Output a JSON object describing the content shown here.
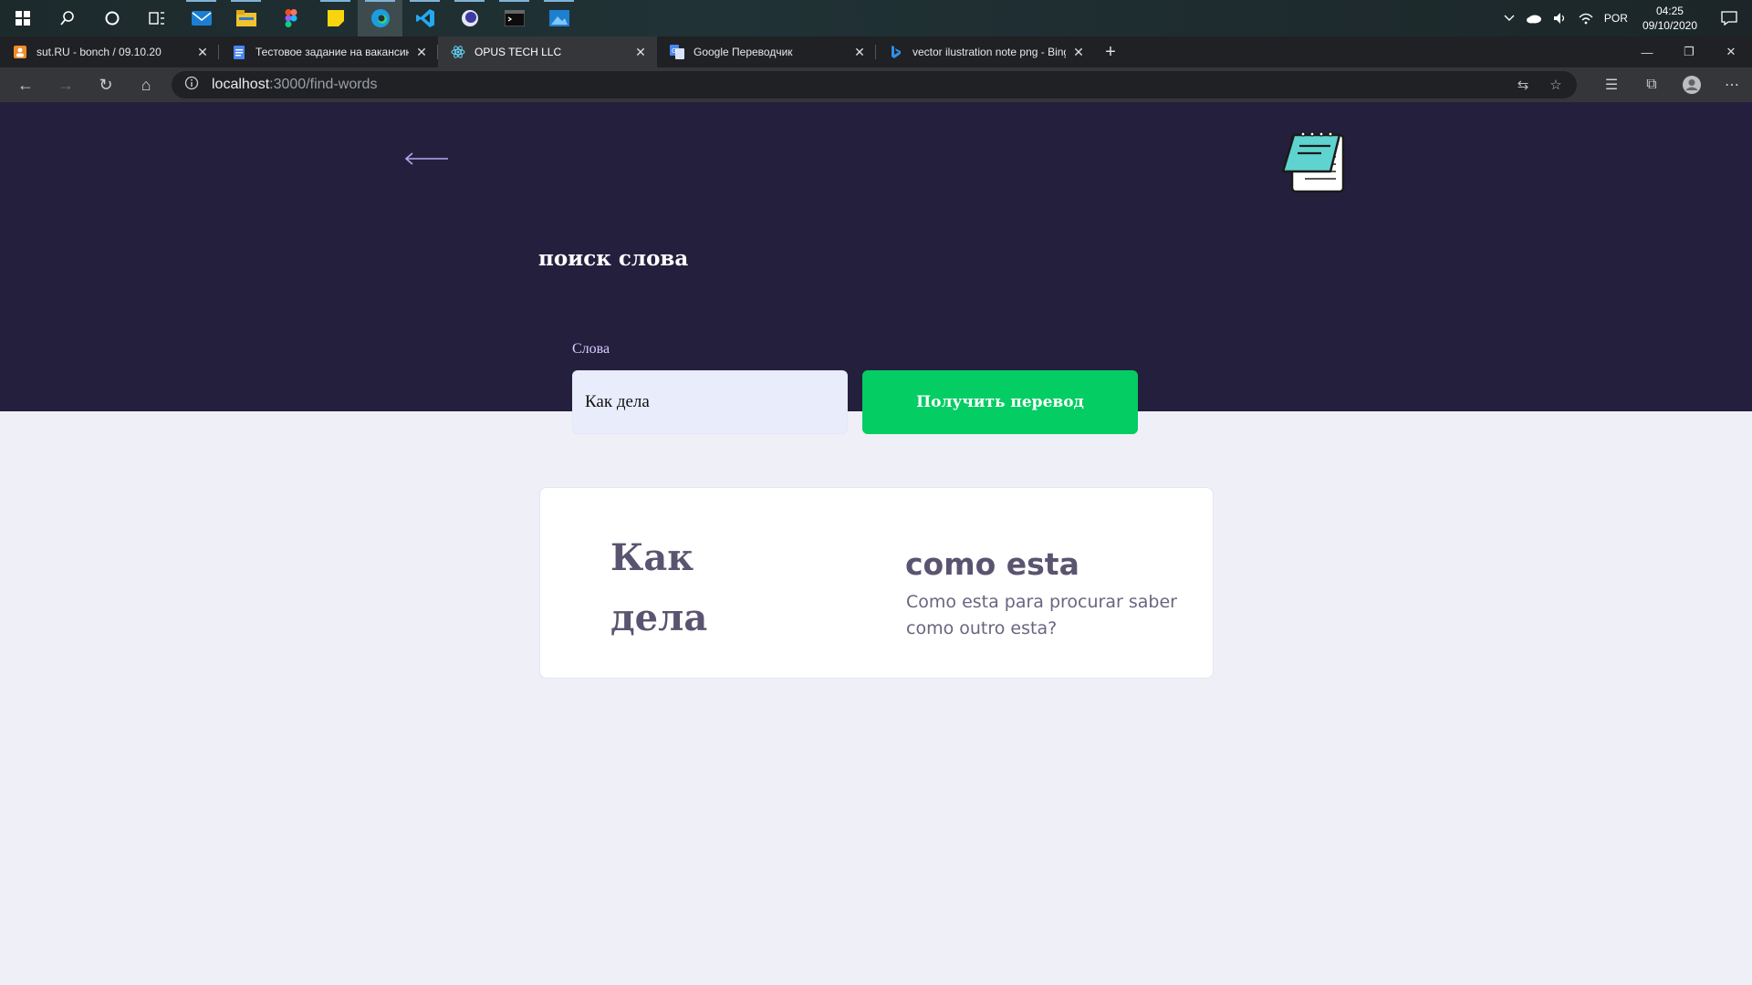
{
  "taskbar": {
    "icons": [
      "windows-start-icon",
      "search-icon",
      "cortana-icon",
      "task-view-icon",
      "mail-icon",
      "file-explorer-icon",
      "figma-icon",
      "sticky-notes-icon",
      "edge-icon",
      "vscode-icon",
      "app-circle-icon",
      "terminal-icon",
      "photos-icon"
    ],
    "tray": {
      "language": "POR",
      "time": "04:25",
      "date": "09/10/2020"
    }
  },
  "browser": {
    "tabs": [
      {
        "title": "sut.RU - bonch / 09.10.20",
        "active": false
      },
      {
        "title": "Тестовое задание на вакансию",
        "active": false
      },
      {
        "title": "OPUS TECH LLC",
        "active": true
      },
      {
        "title": "Google Переводчик",
        "active": false
      },
      {
        "title": "vector ilustration note png - Bing",
        "active": false
      }
    ],
    "address": {
      "host": "localhost",
      "path": ":3000/find-words"
    }
  },
  "page": {
    "title": "поиск слова",
    "form": {
      "label": "Слова",
      "input_value": "Как дела",
      "button_label": "Получить перевод"
    },
    "result": {
      "source_word": "Как дела",
      "translation": "como esta",
      "description": "Como esta para procurar saber como outro esta?"
    },
    "colors": {
      "hero_bg": "#251f3e",
      "page_bg": "#efeff8",
      "button": "#04cd63",
      "label": "#d9ccff",
      "card_text": "#5a5470"
    }
  }
}
